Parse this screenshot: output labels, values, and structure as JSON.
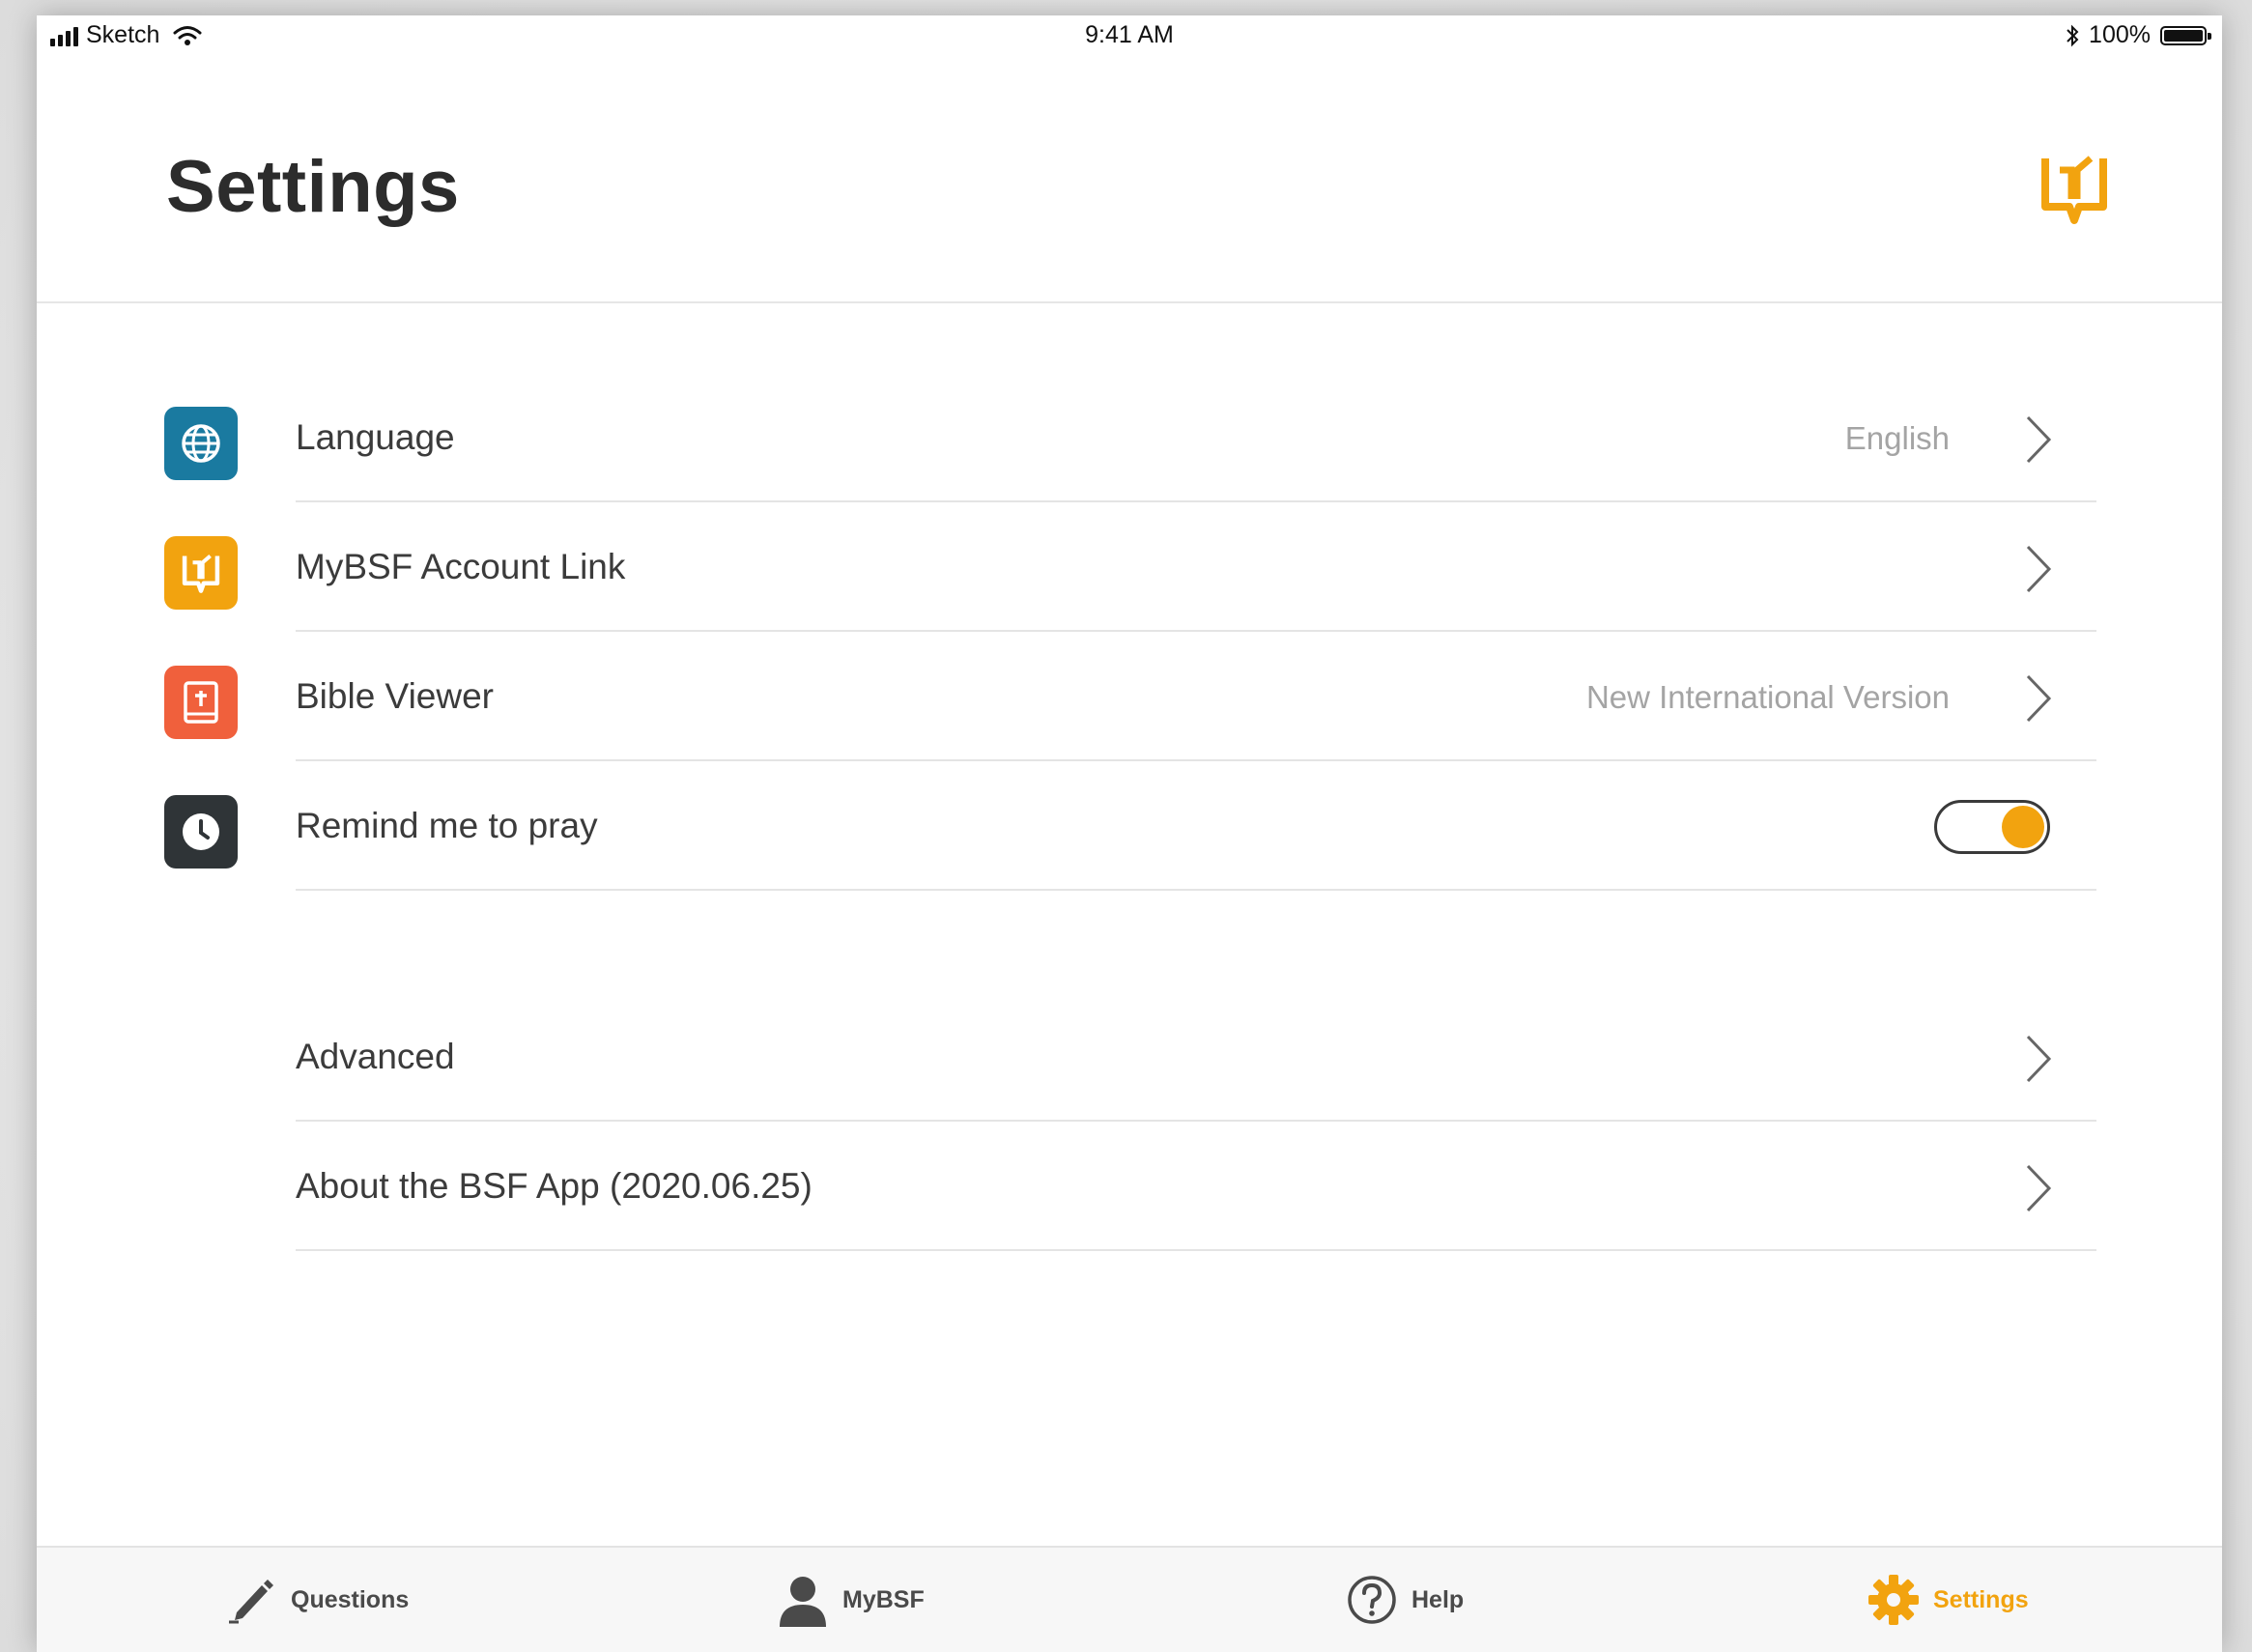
{
  "status_bar": {
    "carrier": "Sketch",
    "time": "9:41 AM",
    "battery": "100%"
  },
  "header": {
    "title": "Settings",
    "logo_icon": "open-book-icon"
  },
  "settings": [
    {
      "label": "Language",
      "value": "English",
      "icon": "globe-icon",
      "icon_color": "#1a7aa0"
    },
    {
      "label": "MyBSF Account Link",
      "value": "",
      "icon": "open-book-icon",
      "icon_color": "#f2a30f"
    },
    {
      "label": "Bible Viewer",
      "value": "New International Version",
      "icon": "bible-icon",
      "icon_color": "#f0603c"
    },
    {
      "label": "Remind me to pray",
      "toggle_on": true,
      "icon": "clock-icon",
      "icon_color": "#2f3437"
    }
  ],
  "other": [
    {
      "label": "Advanced"
    },
    {
      "label": "About the BSF App (2020.06.25)"
    }
  ],
  "tabs": [
    {
      "label": "Questions",
      "icon": "pencil-icon",
      "active": false
    },
    {
      "label": "MyBSF",
      "icon": "person-icon",
      "active": false
    },
    {
      "label": "Help",
      "icon": "question-circle-icon",
      "active": false
    },
    {
      "label": "Settings",
      "icon": "gear-icon",
      "active": true
    }
  ],
  "colors": {
    "accent": "#f2a30f",
    "text": "#3b3b3b",
    "muted": "#a4a4a4"
  }
}
